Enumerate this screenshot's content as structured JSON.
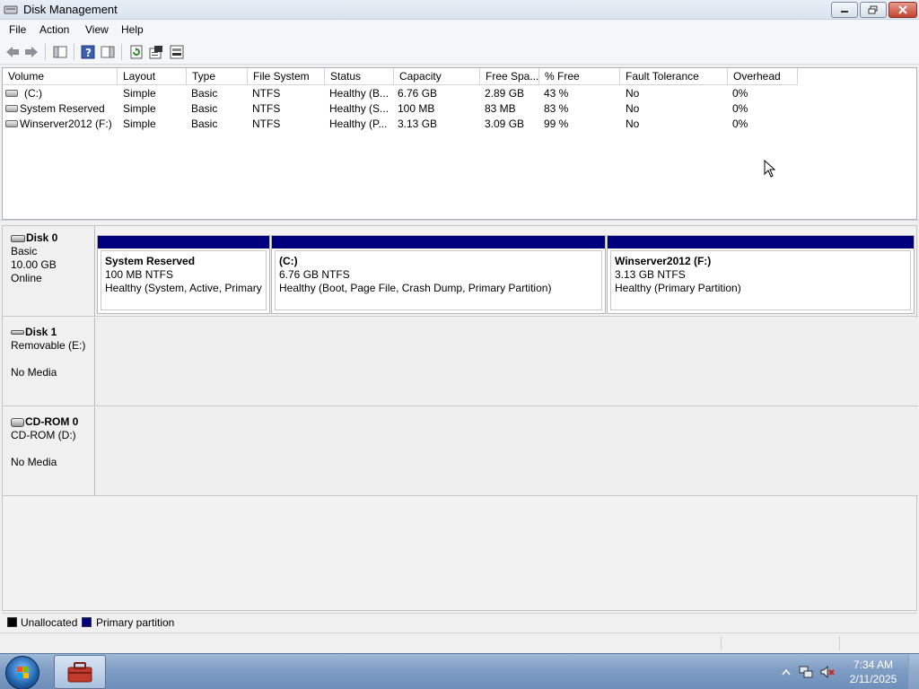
{
  "window": {
    "title": "Disk Management"
  },
  "menu": [
    "File",
    "Action",
    "View",
    "Help"
  ],
  "toolbar": {
    "icons": [
      "back-icon",
      "forward-icon",
      "show-hide-console-tree-icon",
      "help-icon",
      "show-hide-action-pane-icon",
      "refresh-icon",
      "properties-icon",
      "rescan-disks-icon"
    ]
  },
  "volume_table": {
    "columns": [
      "Volume",
      "Layout",
      "Type",
      "File System",
      "Status",
      "Capacity",
      "Free Spa...",
      "% Free",
      "Fault Tolerance",
      "Overhead"
    ],
    "rows": [
      [
        "(C:)",
        "Simple",
        "Basic",
        "NTFS",
        "Healthy (B...",
        "6.76 GB",
        "2.89 GB",
        "43 %",
        "No",
        "0%"
      ],
      [
        "System Reserved",
        "Simple",
        "Basic",
        "NTFS",
        "Healthy (S...",
        "100 MB",
        "83 MB",
        "83 %",
        "No",
        "0%"
      ],
      [
        "Winserver2012 (F:)",
        "Simple",
        "Basic",
        "NTFS",
        "Healthy (P...",
        "3.13 GB",
        "3.09 GB",
        "99 %",
        "No",
        "0%"
      ]
    ]
  },
  "disks": [
    {
      "name": "Disk 0",
      "lines": [
        "Basic",
        "10.00 GB",
        "Online"
      ],
      "partitions": [
        {
          "name": "System Reserved",
          "size": "100 MB NTFS",
          "status": "Healthy (System, Active, Primary Partition)"
        },
        {
          "name": "(C:)",
          "size": "6.76 GB NTFS",
          "status": "Healthy (Boot, Page File, Crash Dump, Primary Partition)"
        },
        {
          "name": "Winserver2012  (F:)",
          "size": "3.13 GB NTFS",
          "status": "Healthy (Primary Partition)"
        }
      ]
    },
    {
      "name": "Disk 1",
      "lines": [
        "Removable (E:)",
        "",
        "No Media"
      ]
    },
    {
      "name": "CD-ROM 0",
      "lines": [
        "CD-ROM (D:)",
        "",
        "No Media"
      ]
    }
  ],
  "legend": [
    {
      "label": "Unallocated",
      "color": "#000000"
    },
    {
      "label": "Primary partition",
      "color": "#00007f"
    }
  ],
  "colors": {
    "primary_partition": "#00007f",
    "unallocated": "#000000"
  },
  "taskbar": {
    "time": "7:34 AM",
    "date": "2/11/2025"
  }
}
